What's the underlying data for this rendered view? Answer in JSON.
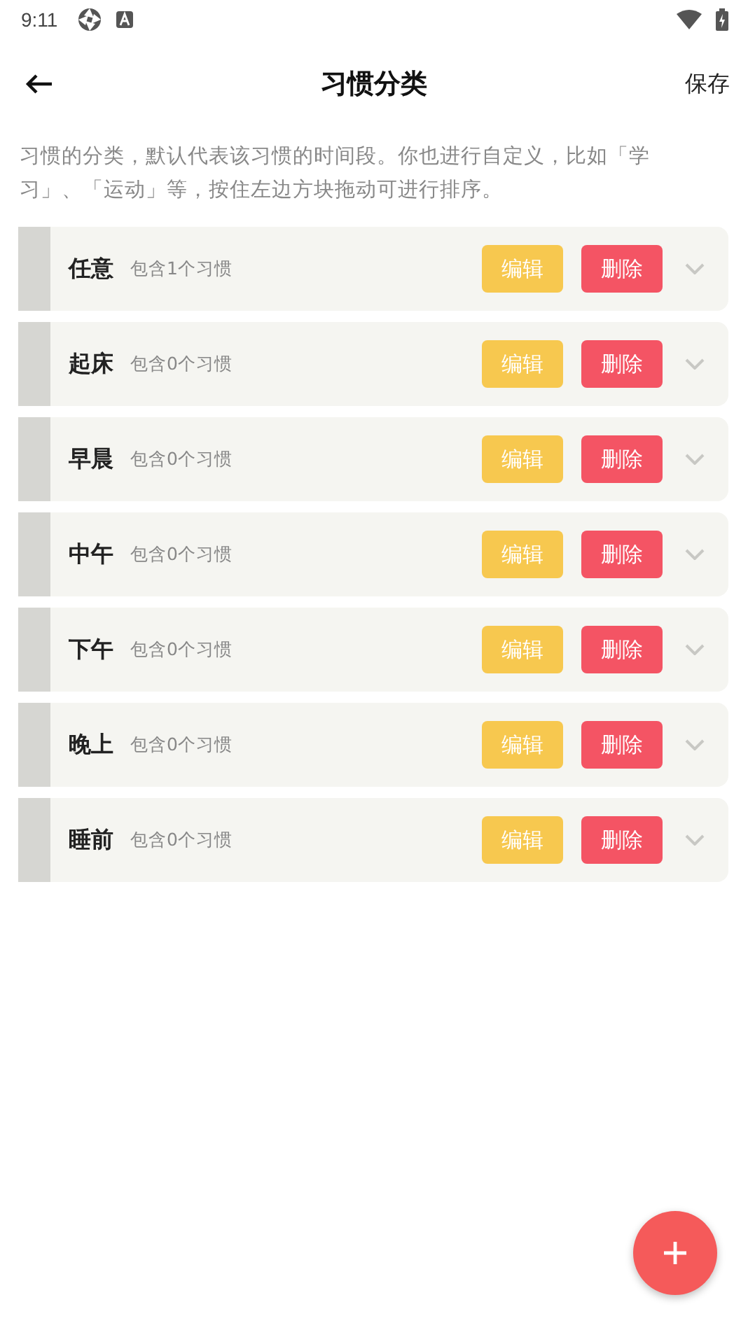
{
  "status_bar": {
    "time": "9:11"
  },
  "header": {
    "title": "习惯分类",
    "save": "保存"
  },
  "description": "习惯的分类，默认代表该习惯的时间段。你也进行自定义，比如「学习」、「运动」等，按住左边方块拖动可进行排序。",
  "categories": [
    {
      "name": "任意",
      "count": "包含1个习惯",
      "edit": "编辑",
      "delete": "删除",
      "expanded": false
    },
    {
      "name": "起床",
      "count": "包含0个习惯",
      "edit": "编辑",
      "delete": "删除",
      "expanded": false
    },
    {
      "name": "早晨",
      "count": "包含0个习惯",
      "edit": "编辑",
      "delete": "删除",
      "expanded": false
    },
    {
      "name": "中午",
      "count": "包含0个习惯",
      "edit": "编辑",
      "delete": "删除",
      "expanded": false
    },
    {
      "name": "下午",
      "count": "包含0个习惯",
      "edit": "编辑",
      "delete": "删除",
      "expanded": false
    },
    {
      "name": "晚上",
      "count": "包含0个习惯",
      "edit": "编辑",
      "delete": "删除",
      "expanded": false
    },
    {
      "name": "睡前",
      "count": "包含0个习惯",
      "edit": "编辑",
      "delete": "删除",
      "expanded": false
    }
  ]
}
